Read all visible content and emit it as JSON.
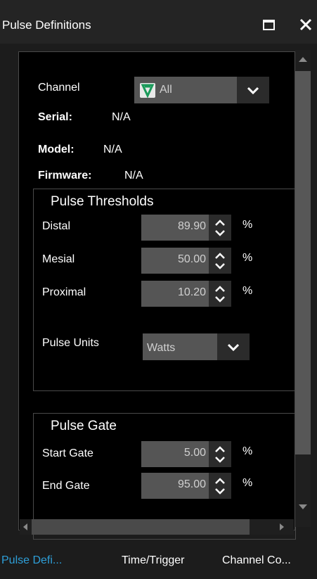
{
  "window": {
    "title": "Pulse Definitions"
  },
  "channel": {
    "label": "Channel",
    "value": "All",
    "serial_label": "Serial:",
    "serial_value": "N/A",
    "model_label": "Model:",
    "model_value": "N/A",
    "firmware_label": "Firmware:",
    "firmware_value": "N/A"
  },
  "thresholds": {
    "title": "Pulse Thresholds",
    "unit": "%",
    "distal_label": "Distal",
    "distal_value": "89.90",
    "mesial_label": "Mesial",
    "mesial_value": "50.00",
    "proximal_label": "Proximal",
    "proximal_value": "10.20",
    "units_label": "Pulse Units",
    "units_value": "Watts"
  },
  "gate": {
    "title": "Pulse Gate",
    "unit": "%",
    "start_label": "Start Gate",
    "start_value": "5.00",
    "end_label": "End Gate",
    "end_value": "95.00"
  },
  "tabs": {
    "t0": "Pulse Defi...",
    "t1": "Time/Trigger",
    "t2": "Channel Co..."
  },
  "colors": {
    "accent": "#2e9fd8",
    "channel_icon": "#1a9a5a"
  }
}
